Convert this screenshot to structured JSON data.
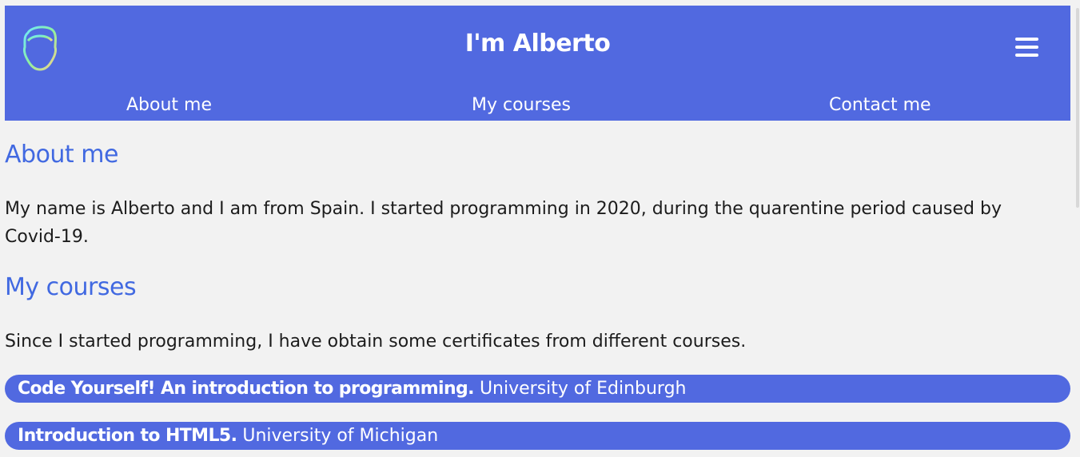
{
  "header": {
    "title": "I'm Alberto",
    "logo_icon": "face-outline-logo-icon",
    "menu_icon": "hamburger-menu-icon"
  },
  "nav": {
    "items": [
      {
        "label": "About me"
      },
      {
        "label": "My courses"
      },
      {
        "label": "Contact me"
      }
    ]
  },
  "about": {
    "heading": "About me",
    "text": "My name is Alberto and I am from Spain. I started programming in 2020, during the quarentine period caused by Covid-19."
  },
  "courses": {
    "heading": "My courses",
    "intro": "Since I started programming, I have obtain some certificates from different courses.",
    "items": [
      {
        "name": "Code Yourself! An introduction to programming.",
        "institution": "University of Edinburgh"
      },
      {
        "name": "Introduction to HTML5.",
        "institution": "University of Michigan"
      }
    ]
  },
  "colors": {
    "header_bg": "#5169e0",
    "heading": "#4169e1",
    "page_bg": "#f2f2f2"
  }
}
